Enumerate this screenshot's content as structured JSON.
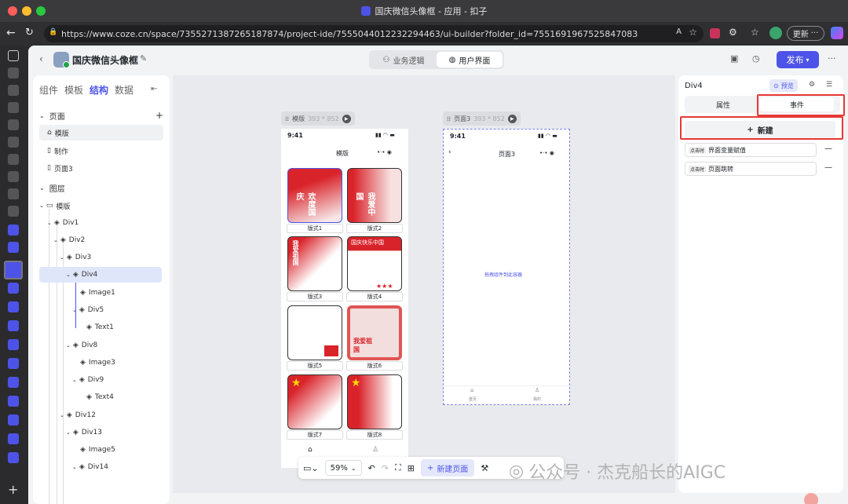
{
  "window": {
    "title": "国庆微信头像框 - 应用 - 扣子"
  },
  "browser": {
    "url": "https://www.coze.cn/space/7355271387265187874/project-ide/7555044012232294463/ui-builder?folder_id=7551691967525847083",
    "update_label": "更新"
  },
  "header": {
    "project_name": "国庆微信头像框",
    "tab_logic": "业务逻辑",
    "tab_ui": "用户界面",
    "publish_label": "发布"
  },
  "left_panel": {
    "tabs": [
      "组件",
      "模板",
      "结构",
      "数据"
    ],
    "pages_heading": "页面",
    "pages": [
      "模版",
      "制作",
      "页面3"
    ],
    "layers_heading": "图层",
    "layers": [
      "模版",
      "Div1",
      "Div2",
      "Div3",
      "Div4",
      "Image1",
      "Div5",
      "Text1",
      "Div8",
      "Image3",
      "Div9",
      "Text4",
      "Div12",
      "Div13",
      "Image5",
      "Div14"
    ]
  },
  "canvas": {
    "frame1": {
      "name": "模版",
      "size": "393 * 852",
      "time": "9:41",
      "title": "模版",
      "thumbs": [
        "版式1",
        "版式2",
        "版式3",
        "版式4",
        "版式5",
        "版式6",
        "版式7",
        "版式8"
      ]
    },
    "frame2": {
      "name": "页面3",
      "size": "393 * 852",
      "time": "9:41",
      "title": "页面3",
      "placeholder": "拖拽组件到此容器",
      "nav": [
        "首页",
        "我的"
      ]
    },
    "thumb_text": {
      "t1": "欢度国庆",
      "t2": "我爱中国",
      "t3": "我爱祖国",
      "t4": "国庆快乐中国",
      "t6": "我爱祖国"
    },
    "zoom": "59%",
    "new_page_label": "新建页面"
  },
  "right_panel": {
    "element_name": "Div4",
    "preview_label": "预览",
    "tab_props": "属性",
    "tab_events": "事件",
    "new_label": "新建",
    "events": [
      {
        "trigger": "点击时",
        "action": "界面变量赋值"
      },
      {
        "trigger": "点击时",
        "action": "页面跳转"
      }
    ]
  },
  "watermark": "公众号 · 杰克船长的AIGC"
}
